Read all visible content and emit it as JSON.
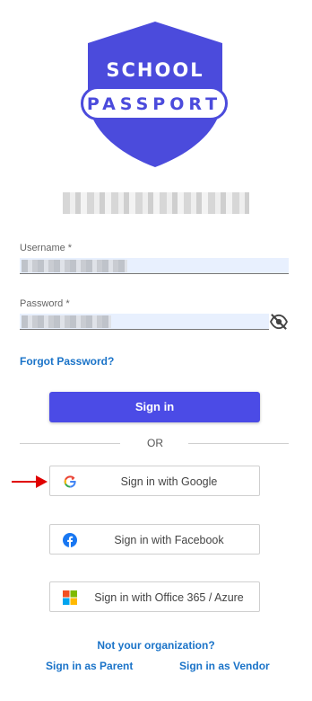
{
  "logo": {
    "line1": "SCHOOL",
    "line2": "PASSPORT"
  },
  "form": {
    "username_label": "Username *",
    "password_label": "Password *",
    "forgot_password": "Forgot Password?",
    "signin_label": "Sign in",
    "or_label": "OR"
  },
  "social": {
    "google": "Sign in with Google",
    "facebook": "Sign in with Facebook",
    "office": "Sign in with Office 365 / Azure"
  },
  "footer": {
    "not_your_org": "Not your organization?",
    "parent": "Sign in as Parent",
    "vendor": "Sign in as Vendor"
  },
  "colors": {
    "brand": "#4b4bdc",
    "link": "#1a73c8",
    "arrow": "#e00000"
  }
}
